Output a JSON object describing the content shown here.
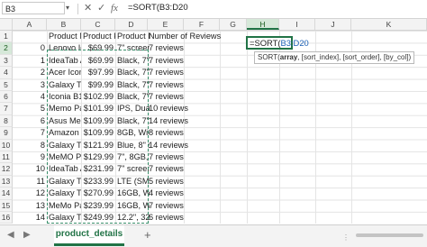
{
  "formula_bar": {
    "name_box": "B3",
    "cancel": "✕",
    "enter": "✓",
    "fx": "fx",
    "formula": "=SORT(B3:D20"
  },
  "columns": [
    "A",
    "B",
    "C",
    "D",
    "E",
    "F",
    "G",
    "H",
    "I",
    "J",
    "K"
  ],
  "rows": [
    "1",
    "2",
    "3",
    "4",
    "5",
    "6",
    "7",
    "8",
    "9",
    "10",
    "11",
    "12",
    "13",
    "14",
    "15",
    "16"
  ],
  "headers": {
    "b": "Product N",
    "c": "Product Pr",
    "d": "Product D",
    "e": "Number of Reviews"
  },
  "table": [
    {
      "a": "0",
      "b": "Lenovo Id",
      "c": "$69.99",
      "d": "7\" screen,",
      "e": "7 reviews"
    },
    {
      "a": "1",
      "b": "IdeaTab A",
      "c": "$69.99",
      "d": "Black, 7\" s",
      "e": "7 reviews"
    },
    {
      "a": "2",
      "b": "Acer Iconi",
      "c": "$97.99",
      "d": "Black, 7\" s",
      "e": "7 reviews"
    },
    {
      "a": "3",
      "b": "Galaxy Tab",
      "c": "$99.99",
      "d": "Black, 7\" s",
      "e": "7 reviews"
    },
    {
      "a": "4",
      "b": "Iconia B1-",
      "c": "$102.99",
      "d": "Black, 7\" s",
      "e": "7 reviews"
    },
    {
      "a": "5",
      "b": "Memo Pac",
      "c": "$101.99",
      "d": "IPS, Dual-",
      "e": "10 reviews"
    },
    {
      "a": "6",
      "b": "Asus MeMo",
      "c": "$109.99",
      "d": "Black, 7\" s",
      "e": "14 reviews"
    },
    {
      "a": "7",
      "b": "Amazon K",
      "c": "$109.99",
      "d": "8GB, Wi-Fi",
      "e": "8 reviews"
    },
    {
      "a": "8",
      "b": "Galaxy Tab",
      "c": "$121.99",
      "d": "Blue, 8\" sc",
      "e": "14 reviews"
    },
    {
      "a": "9",
      "b": "MeMO Pac",
      "c": "$129.99",
      "d": "7\", 8GB, G",
      "e": "7 reviews"
    },
    {
      "a": "10",
      "b": "IdeaTab A",
      "c": "$231.99",
      "d": "7\" screen,",
      "e": "7 reviews"
    },
    {
      "a": "11",
      "b": "Galaxy Tab",
      "c": "$233.99",
      "d": "LTE (SM-T",
      "e": "5 reviews"
    },
    {
      "a": "12",
      "b": "Galaxy Tab",
      "c": "$270.99",
      "d": "16GB, Wi-",
      "e": "4 reviews"
    },
    {
      "a": "13",
      "b": "MeMo Pac",
      "c": "$239.99",
      "d": "16GB, Wi-",
      "e": "7 reviews"
    },
    {
      "a": "14",
      "b": "Galaxy Tab",
      "c": "$249.99",
      "d": "12.2\", 32G",
      "e": "6 reviews"
    }
  ],
  "active_cell": {
    "prefix": "=SORT(",
    "ref": "B3:D20"
  },
  "tooltip": {
    "fn": "SORT(",
    "arg1": "array",
    "rest": ", [sort_index], [sort_order], [by_col])"
  },
  "sheet_tab": "product_details",
  "add_sheet": "+",
  "nav_prev": "◀",
  "nav_next": "▶",
  "scroll_dots": "⋮"
}
